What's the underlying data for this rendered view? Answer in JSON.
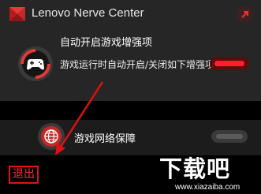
{
  "app": {
    "title": "Lenovo Nerve Center",
    "logo_icon": "lenovo-legion-logo",
    "pin_icon": "arrow-up-right-icon"
  },
  "features": [
    {
      "title": "自动开启游戏增强项",
      "description": "游戏运行时自动开启/关闭如下增强项",
      "icon": "gamepad-icon",
      "enabled": true
    },
    {
      "title": "游戏网络保障",
      "icon": "globe-icon",
      "enabled": false
    }
  ],
  "footer": {
    "exit_label": "退出"
  },
  "watermark": {
    "text": "下载吧",
    "url": "www.xiazaiba.com"
  },
  "colors": {
    "accent": "#ff1f2d",
    "annotation": "#e01010",
    "background": "#000000",
    "panel": "#262626"
  }
}
